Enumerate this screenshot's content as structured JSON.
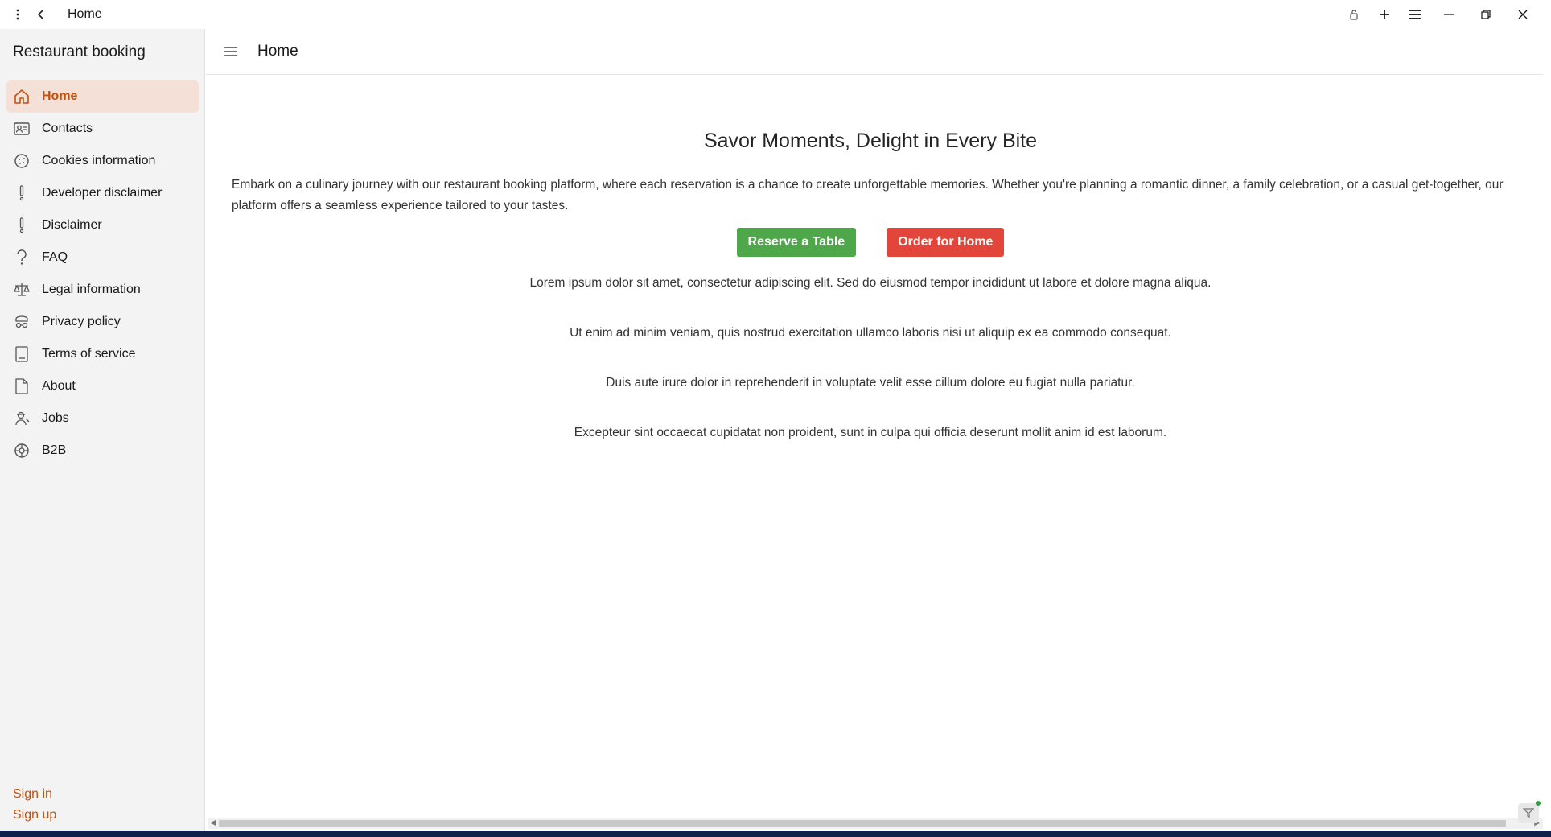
{
  "titlebar": {
    "title": "Home",
    "icons": [
      "more-vertical-icon",
      "back-arrow-icon",
      "lock-icon",
      "plus-icon",
      "menu-lines-icon",
      "minimize-icon",
      "restore-icon",
      "close-icon"
    ]
  },
  "sidebar": {
    "app_title": "Restaurant booking",
    "items": [
      {
        "label": "Home",
        "icon": "home-icon",
        "active": true
      },
      {
        "label": "Contacts",
        "icon": "contact-card-icon"
      },
      {
        "label": "Cookies information",
        "icon": "cookie-icon"
      },
      {
        "label": "Developer disclaimer",
        "icon": "exclamation-icon"
      },
      {
        "label": "Disclaimer",
        "icon": "exclamation-icon"
      },
      {
        "label": "FAQ",
        "icon": "question-icon"
      },
      {
        "label": "Legal information",
        "icon": "scales-icon"
      },
      {
        "label": "Privacy policy",
        "icon": "privacy-icon"
      },
      {
        "label": "Terms of service",
        "icon": "document-lines-icon"
      },
      {
        "label": "About",
        "icon": "page-icon"
      },
      {
        "label": "Jobs",
        "icon": "worker-icon"
      },
      {
        "label": "B2B",
        "icon": "handshake-icon"
      }
    ],
    "sign_in": "Sign in",
    "sign_up": "Sign up"
  },
  "main": {
    "header_title": "Home",
    "hero_title": "Savor Moments, Delight in Every Bite",
    "intro": "Embark on a culinary journey with our restaurant booking platform, where each reservation is a chance to create unforgettable memories. Whether you're planning a romantic dinner, a family celebration, or a casual get-together, our platform offers a seamless experience tailored to your tastes.",
    "reserve_button": "Reserve a Table",
    "order_button": "Order for Home",
    "paragraphs": [
      "Lorem ipsum dolor sit amet, consectetur adipiscing elit. Sed do eiusmod tempor incididunt ut labore et dolore magna aliqua.",
      "Ut enim ad minim veniam, quis nostrud exercitation ullamco laboris nisi ut aliquip ex ea commodo consequat.",
      "Duis aute irure dolor in reprehenderit in voluptate velit esse cillum dolore eu fugiat nulla pariatur.",
      "Excepteur sint occaecat cupidatat non proident, sunt in culpa qui officia deserunt mollit anim id est laborum."
    ]
  },
  "colors": {
    "accent": "#c2510f",
    "active_bg": "#f4e0d6",
    "reserve": "#4ea84a",
    "order": "#e2463a"
  }
}
